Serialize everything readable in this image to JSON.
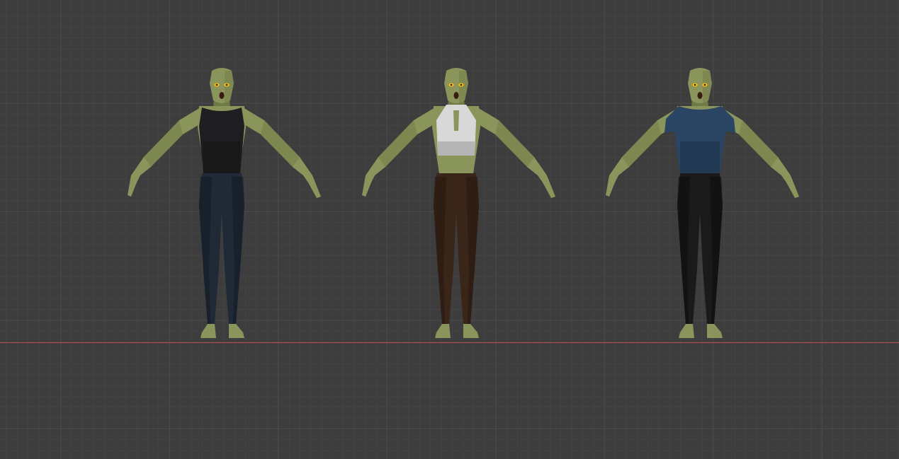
{
  "viewport": {
    "background_color": "#3d3d3d",
    "grid_minor_color": "#454545",
    "grid_major_color": "#4a4a4a",
    "x_axis_color": "#a84c55"
  },
  "characters": [
    {
      "name": "character-black-top-navy-pants",
      "skin_color": "#8a955b",
      "skin_shadow": "#6f7a46",
      "eye_color": "#e8b21a",
      "mouth_color": "#3a1a12",
      "top_color": "#1e1e20",
      "top_shadow": "#141416",
      "pants_color": "#1f2a36",
      "pants_shadow": "#141c26",
      "top_style": "tank"
    },
    {
      "name": "character-white-halter-brown-pants",
      "skin_color": "#8a955b",
      "skin_shadow": "#6f7a46",
      "eye_color": "#e8b21a",
      "mouth_color": "#3a1a12",
      "top_color": "#d8d8d8",
      "top_shadow": "#b5b5b5",
      "pants_color": "#3a2519",
      "pants_shadow": "#2a1a11",
      "top_style": "halter"
    },
    {
      "name": "character-blue-shirt-black-pants",
      "skin_color": "#8a955b",
      "skin_shadow": "#6f7a46",
      "eye_color": "#e8b21a",
      "mouth_color": "#3a1a12",
      "top_color": "#2a4563",
      "top_shadow": "#1f354e",
      "pants_color": "#1a1a1b",
      "pants_shadow": "#101011",
      "top_style": "tshirt"
    }
  ]
}
